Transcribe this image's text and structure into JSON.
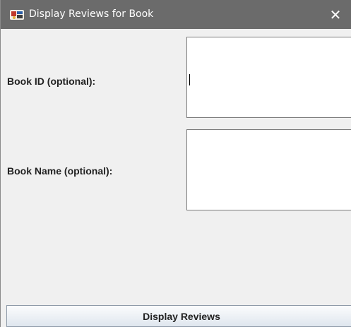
{
  "window": {
    "title": "Display Reviews for Book",
    "icon": "java-app-icon",
    "close_glyph": "✕"
  },
  "form": {
    "book_id_label": "Book ID (optional):",
    "book_id_value": "",
    "book_name_label": "Book Name (optional):",
    "book_name_value": ""
  },
  "actions": {
    "display_reviews_label": "Display Reviews"
  },
  "colors": {
    "titlebar": "#6b6b6b",
    "background": "#f0f0f0",
    "field_background": "#ffffff"
  }
}
